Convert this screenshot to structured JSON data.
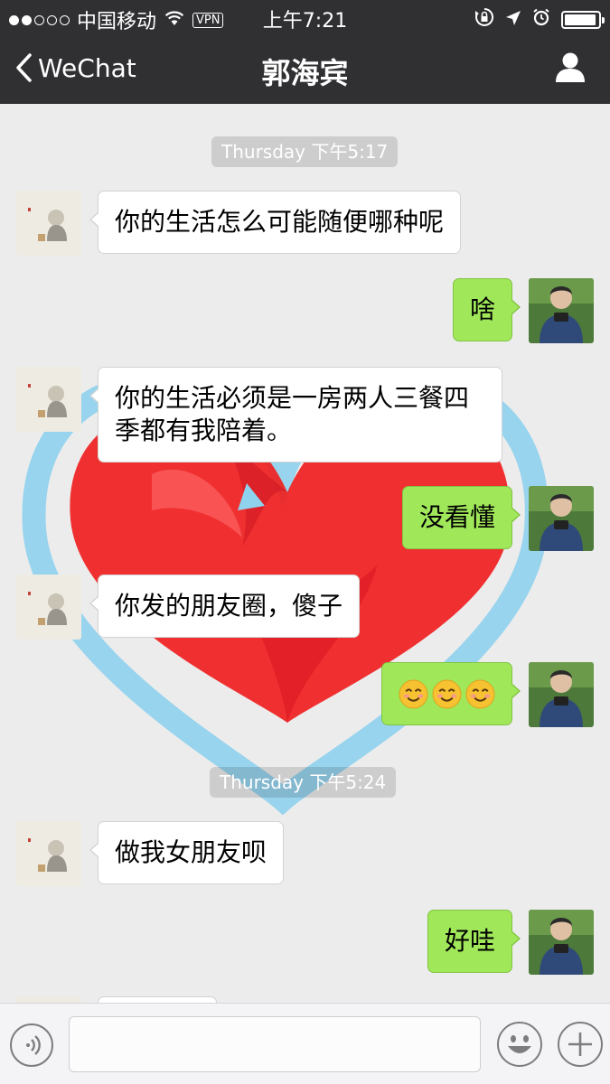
{
  "status_bar": {
    "carrier": "中国移动",
    "vpn": "VPN",
    "time": "上午7:21",
    "signal_bars": 2,
    "battery_level": 0.95
  },
  "nav": {
    "back_label": "WeChat",
    "title": "郭海宾"
  },
  "chat": {
    "background_image": "red-heart-with-blue-outline",
    "timestamps": [
      "Thursday 下午5:17",
      "Thursday 下午5:24"
    ],
    "messages": [
      {
        "side": "in",
        "text": "你的生活怎么可能随便哪种呢"
      },
      {
        "side": "out",
        "text": "啥"
      },
      {
        "side": "in",
        "lines": [
          "你的生活必须是一房两人三餐四",
          "季都有我陪着。"
        ]
      },
      {
        "side": "out",
        "text": "没看懂"
      },
      {
        "side": "in",
        "text": "你发的朋友圈，傻子"
      },
      {
        "side": "out",
        "emoji": [
          "smiling-face-emoji",
          "smiling-face-emoji",
          "smiling-face-emoji"
        ]
      },
      {
        "side": "in",
        "text": "做我女朋友呗"
      },
      {
        "side": "out",
        "text": "好哇"
      }
    ]
  },
  "input_bar": {
    "message_value": "",
    "icons": [
      "voice-icon",
      "emoji-icon",
      "plus-icon"
    ]
  },
  "colors": {
    "bar_dark": "#303033",
    "chat_bg": "#ececec",
    "bubble_out": "#a0e75a",
    "bubble_in": "#ffffff",
    "heart_red": "#f02020",
    "heart_blue": "#8fd2ee"
  }
}
